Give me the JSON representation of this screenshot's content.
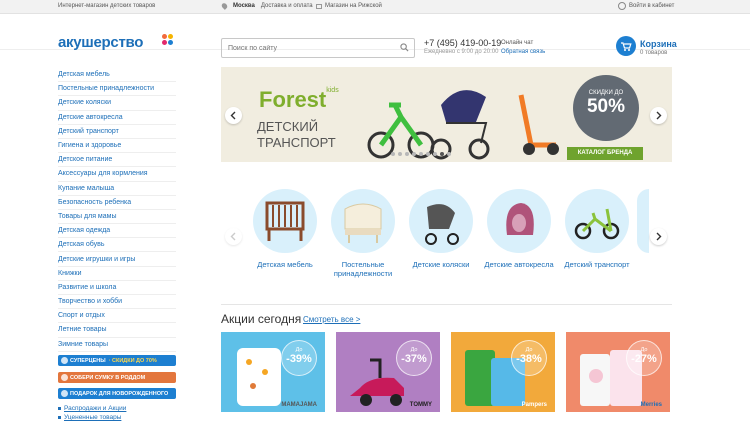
{
  "topbar": {
    "tagline": "Интернет-магазин детских товаров",
    "city": "Москва",
    "delivery": "Доставка и оплата",
    "store": "Магазин на Рижской",
    "login": "Войти в кабинет"
  },
  "header": {
    "logo": "акушерство",
    "search_placeholder": "Поиск по сайту",
    "phone": "+7 (495) 419-00-19",
    "hours": "Ежедневно с 9:00 до 20:00",
    "chat": "Онлайн чат",
    "feedback": "Обратная связь",
    "cart_title": "Корзина",
    "cart_count": "0 товаров"
  },
  "sidebar": {
    "items": [
      "Детская мебель",
      "Постельные принадлежности",
      "Детские коляски",
      "Детские автокресла",
      "Детский транспорт",
      "Гигиена и здоровье",
      "Детское питание",
      "Аксессуары для кормления",
      "Купание малыша",
      "Безопасность ребенка",
      "Товары для мамы",
      "Детская одежда",
      "Детская обувь",
      "Детские игрушки и игры",
      "Книжки",
      "Развитие и школа",
      "Творчество и хобби",
      "Спорт и отдых",
      "Летние товары",
      "Зимние товары"
    ],
    "promos": [
      {
        "label": "Суперцены",
        "accent": "· Скидки до 70%",
        "color": "#1d7fd1"
      },
      {
        "label": "Собери сумку в роддом",
        "accent": "",
        "color": "#e3763d"
      },
      {
        "label": "Подарок для новорожденного",
        "accent": "",
        "color": "#1d7fd1"
      }
    ],
    "links": [
      "Распродажи и Акции",
      "Уцененные товары"
    ]
  },
  "banner": {
    "brand": "Forest",
    "brand_suffix": "kids",
    "title_line1": "ДЕТСКИЙ",
    "title_line2": "ТРАНСПОРТ",
    "badge_text": "скидки до",
    "badge_percent": "50%",
    "catalog_button": "Каталог бренда",
    "slide_count": 9,
    "active_slide": 7
  },
  "categories": [
    "Детская мебель",
    "Постельные принадлежности",
    "Детские коляски",
    "Детские автокресла",
    "Детский транспорт"
  ],
  "deals": {
    "title": "Акции сегодня",
    "link": "Смотреть все >",
    "cards": [
      {
        "prefix": "До",
        "discount": "-39%",
        "bg": "#5ec0e8",
        "brand": "MAMAJAMA"
      },
      {
        "prefix": "До",
        "discount": "-37%",
        "bg": "#b07fc2",
        "brand": "TOMMY"
      },
      {
        "prefix": "До",
        "discount": "-38%",
        "bg": "#f2a93b",
        "brand": "Pampers"
      },
      {
        "prefix": "До",
        "discount": "-27%",
        "bg": "#f08a6a",
        "brand": "Merries"
      }
    ]
  },
  "colors": {
    "brand_blue": "#1d6fb8",
    "banner_green": "#7fae2d",
    "logo_dots": [
      "#f26a3c",
      "#f5b400",
      "#e3296b",
      "#1d7fd1"
    ]
  }
}
